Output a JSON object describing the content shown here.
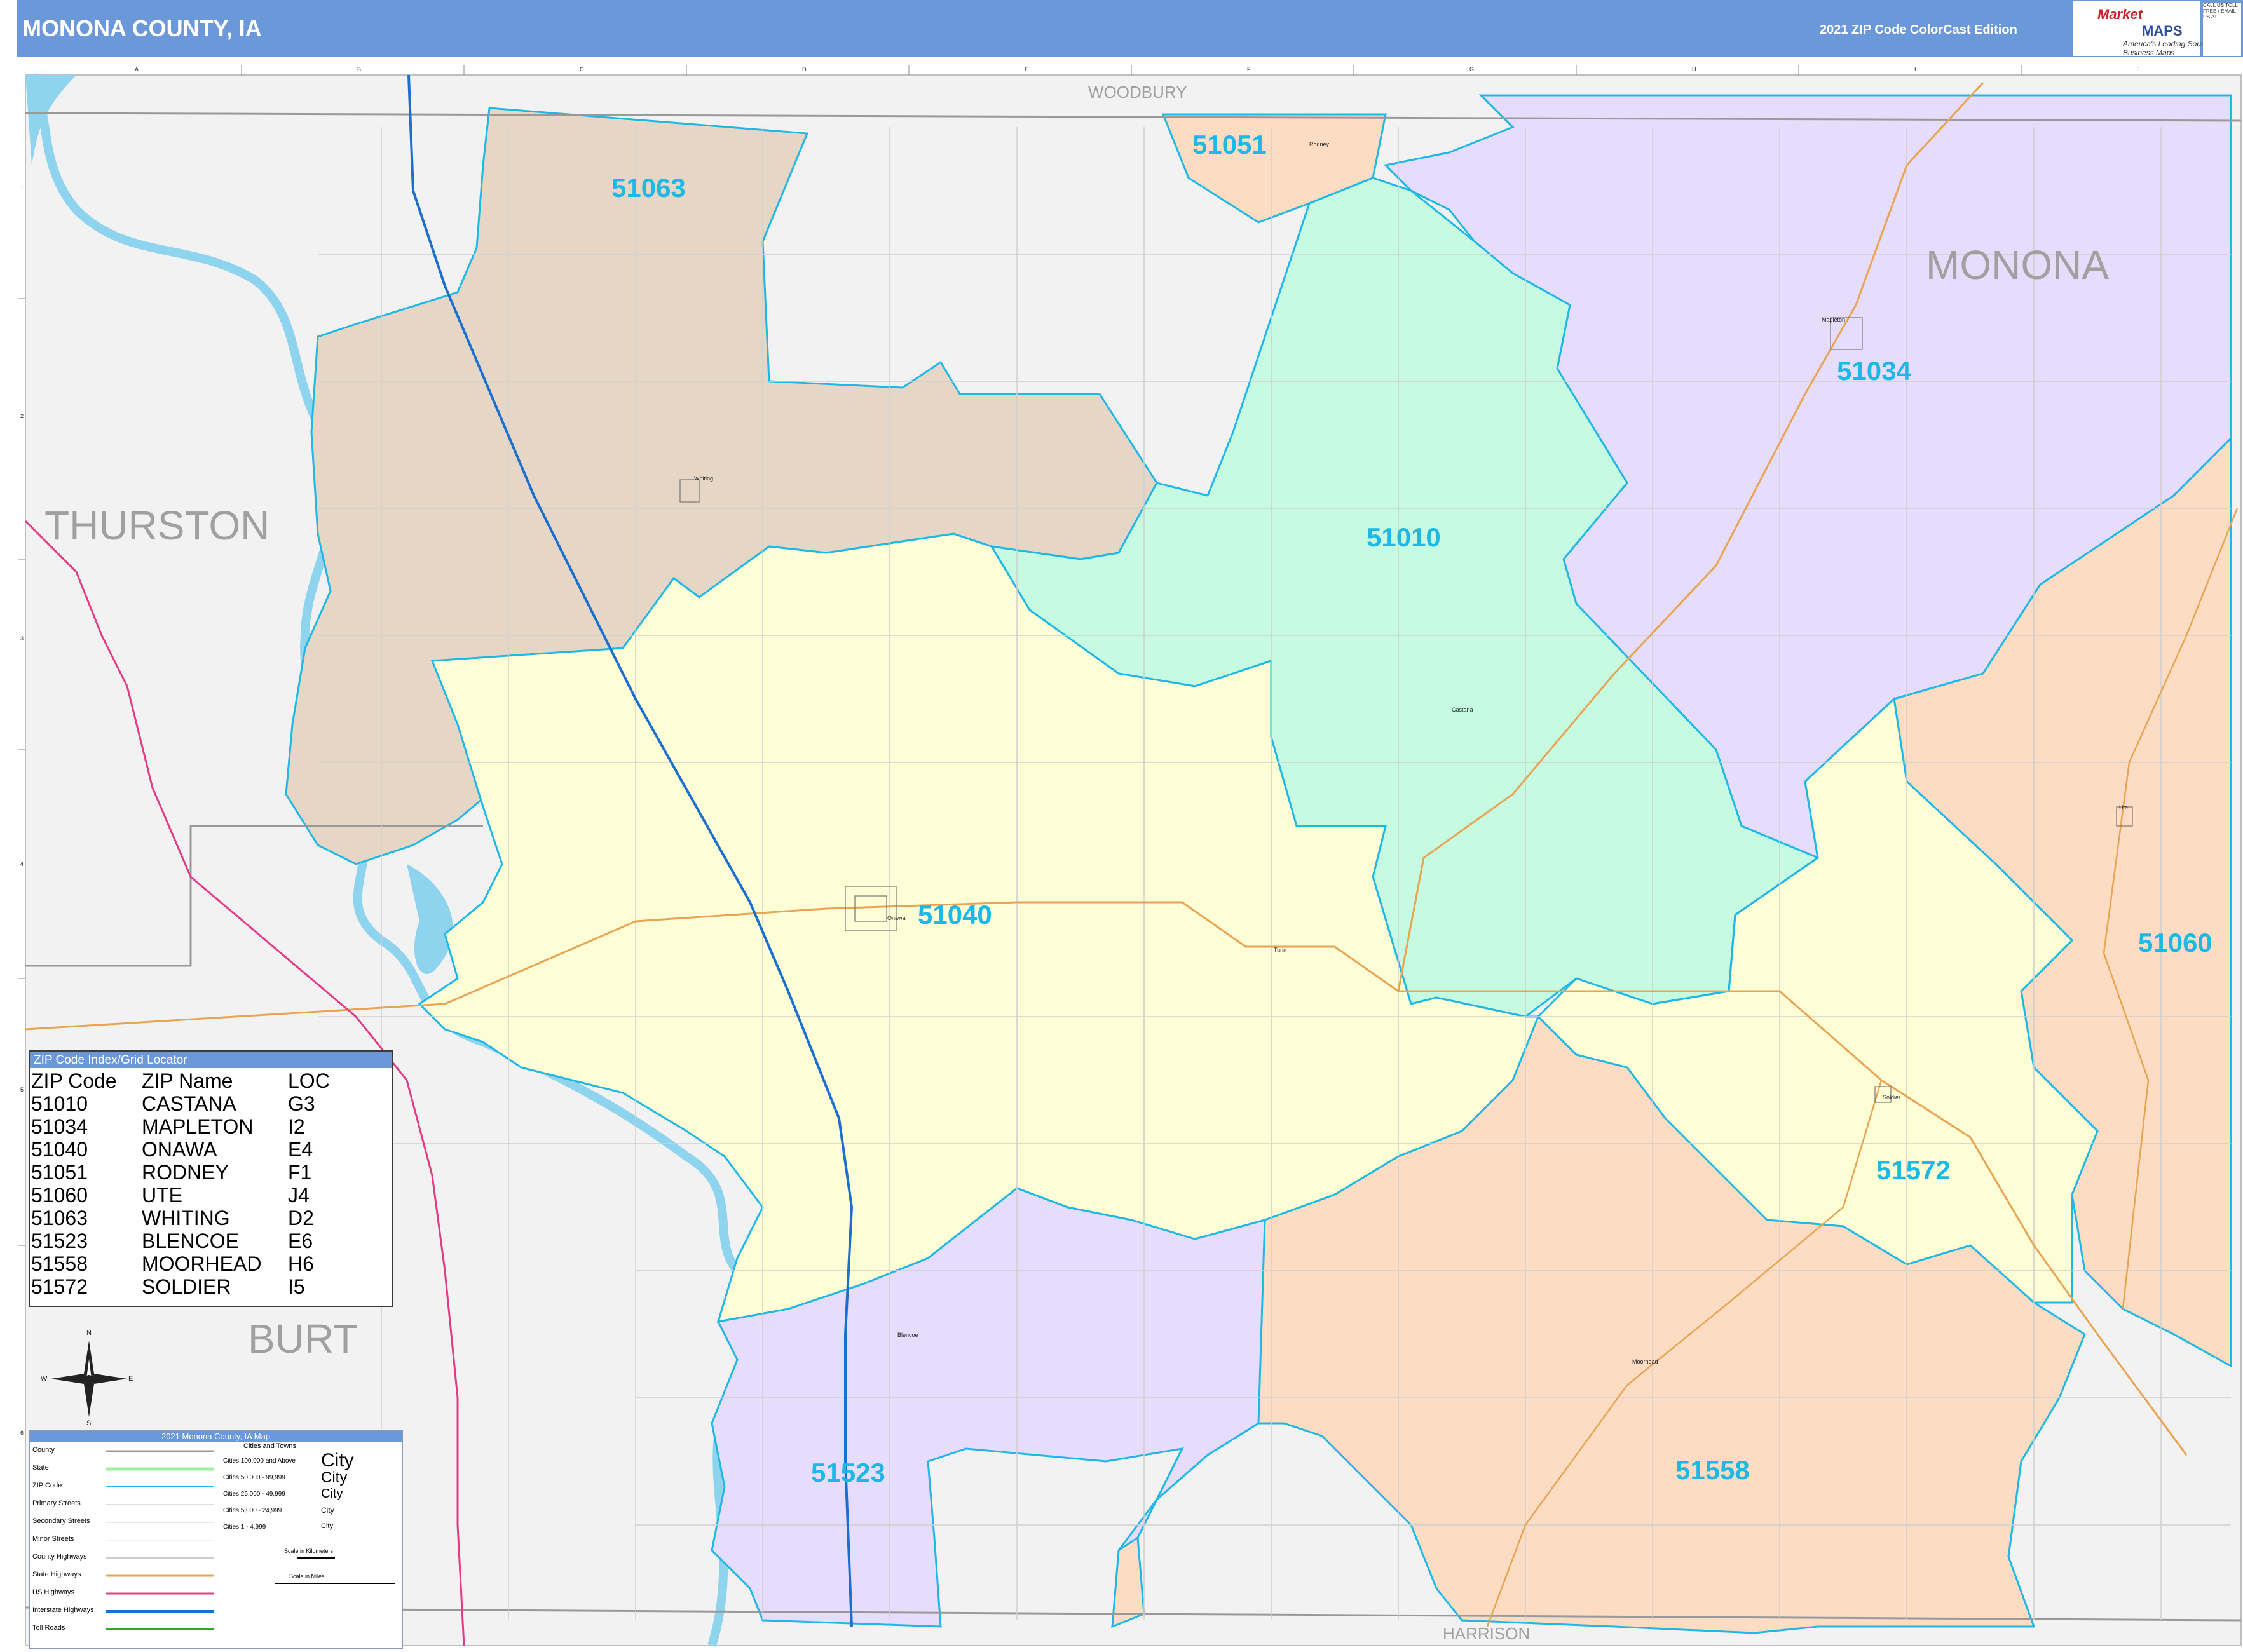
{
  "header": {
    "title": "MONONA COUNTY, IA",
    "edition": "2021 ZIP Code ColorCast Edition"
  },
  "logo": {
    "market": "Market",
    "maps": "MAPS",
    "tagline": "America's Leading Source of Business Maps",
    "contact": "CALL US TOLL FREE / EMAIL US AT"
  },
  "colors": {
    "header_bg": "#6b98d8",
    "zip_label": "#1fb8e6",
    "zip_border": "#1fb8e6",
    "zip_51063": "#e6d6c6",
    "zip_51010": "#c6fbe2",
    "zip_51034": "#e6dcfb",
    "zip_51040": "#fdfdd6",
    "zip_51051": "#fcdcc2",
    "zip_51060": "#fcdcc2",
    "zip_51558": "#fcdcc2",
    "zip_51523": "#e6dcfb",
    "zip_51572": "#fdfdd6",
    "river": "#8ed4ee",
    "interstate": "#1b6fd0",
    "us_highway": "#e23c86",
    "state_highway": "#e8a452",
    "outside": "#f2f2f2"
  },
  "zip_labels": [
    "51063",
    "51051",
    "51034",
    "51010",
    "51040",
    "51060",
    "51572",
    "51523",
    "51558"
  ],
  "county_labels": {
    "woodbury": "WOODBURY",
    "monona": "MONONA",
    "thurston": "THURSTON",
    "burt": "BURT",
    "harrison": "HARRISON"
  },
  "towns": [
    "Rodney",
    "Mapleton",
    "Whiting",
    "Castana",
    "Onawa",
    "Turin",
    "Ute",
    "Soldier",
    "Blencoe",
    "Moorhead"
  ],
  "grid_letters": [
    "A",
    "B",
    "C",
    "D",
    "E",
    "F",
    "G",
    "H",
    "I",
    "J"
  ],
  "grid_numbers": [
    "1",
    "2",
    "3",
    "4",
    "5",
    "6"
  ],
  "zip_index": {
    "title": "ZIP Code Index/Grid Locator",
    "columns": [
      "ZIP Code",
      "ZIP Name",
      "LOC"
    ],
    "rows": [
      [
        "51010",
        "CASTANA",
        "G3"
      ],
      [
        "51034",
        "MAPLETON",
        "I2"
      ],
      [
        "51040",
        "ONAWA",
        "E4"
      ],
      [
        "51051",
        "RODNEY",
        "F1"
      ],
      [
        "51060",
        "UTE",
        "J4"
      ],
      [
        "51063",
        "WHITING",
        "D2"
      ],
      [
        "51523",
        "BLENCOE",
        "E6"
      ],
      [
        "51558",
        "MOORHEAD",
        "H6"
      ],
      [
        "51572",
        "SOLDIER",
        "I5"
      ]
    ]
  },
  "legend": {
    "title": "2021 Monona County, IA Map",
    "items": [
      "County",
      "State",
      "ZIP Code",
      "Primary Streets",
      "Secondary Streets",
      "Minor Streets",
      "County Highways",
      "State Highways",
      "US Highways",
      "Interstate Highways",
      "Toll Roads"
    ],
    "cities_header": "Cities and Towns",
    "city_items": [
      "Cities 100,000 and Above",
      "Cities 50,000 - 99,999",
      "Cities 25,000 - 49,999",
      "Cities 5,000 - 24,999",
      "Cities 1 - 4,999"
    ],
    "city_samples": [
      "City",
      "City",
      "City",
      "City",
      "City"
    ],
    "scale_km": "Scale in Kilometers",
    "scale_mi": "Scale in Miles"
  },
  "compass": {
    "n": "N",
    "s": "S",
    "e": "E",
    "w": "W"
  }
}
